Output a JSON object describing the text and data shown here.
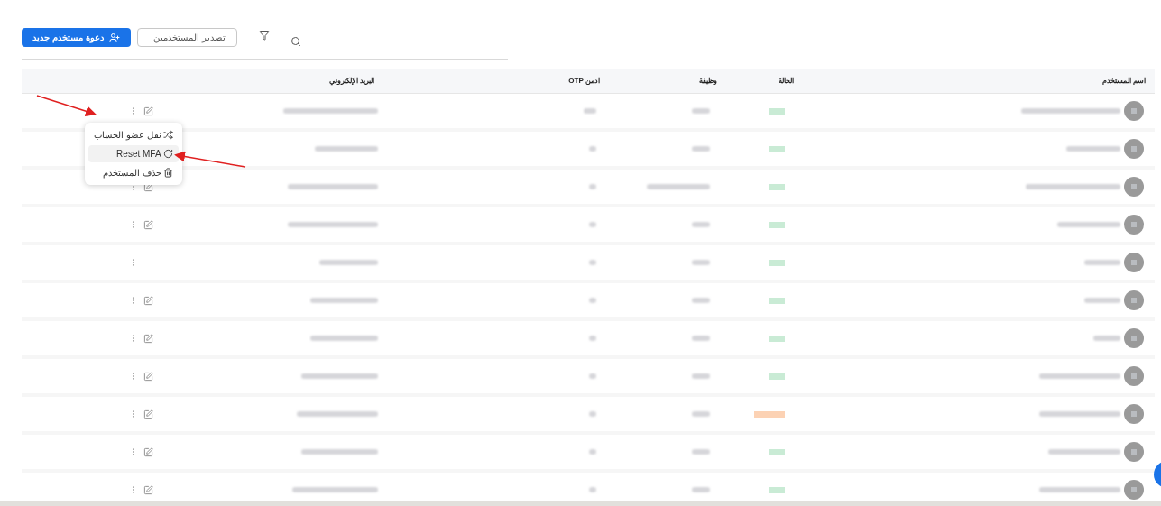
{
  "toolbar": {
    "invite_button": "دعوة مستخدم جديد",
    "export_button": "تصدير المستخدمين"
  },
  "table": {
    "columns": [
      "اسم المستخدم",
      "الحالة",
      "وظيفة",
      "ادمن OTP",
      "البريد الإلكتروني"
    ],
    "rows": [
      {
        "color": "#c9ebd5",
        "editable": true
      },
      {
        "color": "#c9ebd5"
      },
      {
        "color": "#c9ebd5",
        "editable": true
      },
      {
        "color": "#c9ebd5",
        "editable": true
      },
      {
        "color": "#c9ebd5",
        "editable": false
      },
      {
        "color": "#c9ebd5",
        "editable": true
      },
      {
        "color": "#c9ebd5",
        "editable": true
      },
      {
        "color": "#c9ebd5",
        "editable": true
      },
      {
        "color": "#fcd2b4",
        "editable": true
      },
      {
        "color": "#c9ebd5",
        "editable": true
      },
      {
        "color": "#c9ebd5",
        "editable": true
      }
    ]
  },
  "row_menu": {
    "items": [
      {
        "kind": "move",
        "label": "نقل عضو الحساب",
        "selected": false
      },
      {
        "kind": "reset",
        "label": "Reset MFA",
        "selected": true
      },
      {
        "kind": "delete",
        "label": "حذف المستخدم",
        "selected": false
      }
    ]
  }
}
